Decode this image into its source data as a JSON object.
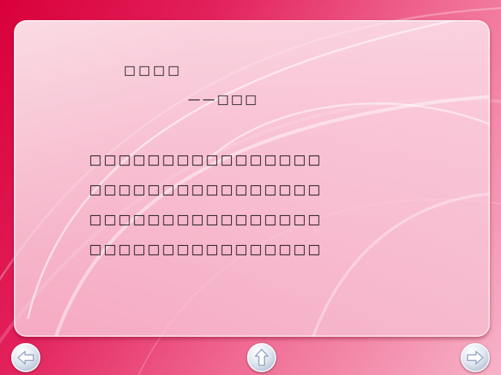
{
  "slide": {
    "title": "□□□□",
    "author": "——□□□",
    "poem_lines": [
      "□□□□□□□□□□□□□□□□",
      "□□□□□□□□□□□□□□□□",
      "□□□□□□□□□□□□□□□□",
      "□□□□□□□□□□□□□□□□"
    ]
  },
  "navigation": {
    "prev_icon": "arrow-left-icon",
    "up_icon": "arrow-up-icon",
    "next_icon": "arrow-right-icon"
  },
  "colors": {
    "background": "#e2205a",
    "panel": "#fbdde8",
    "text": "#111111",
    "button_arrow": "#ffffff",
    "button_arrow_outline": "#8f9fbd"
  }
}
